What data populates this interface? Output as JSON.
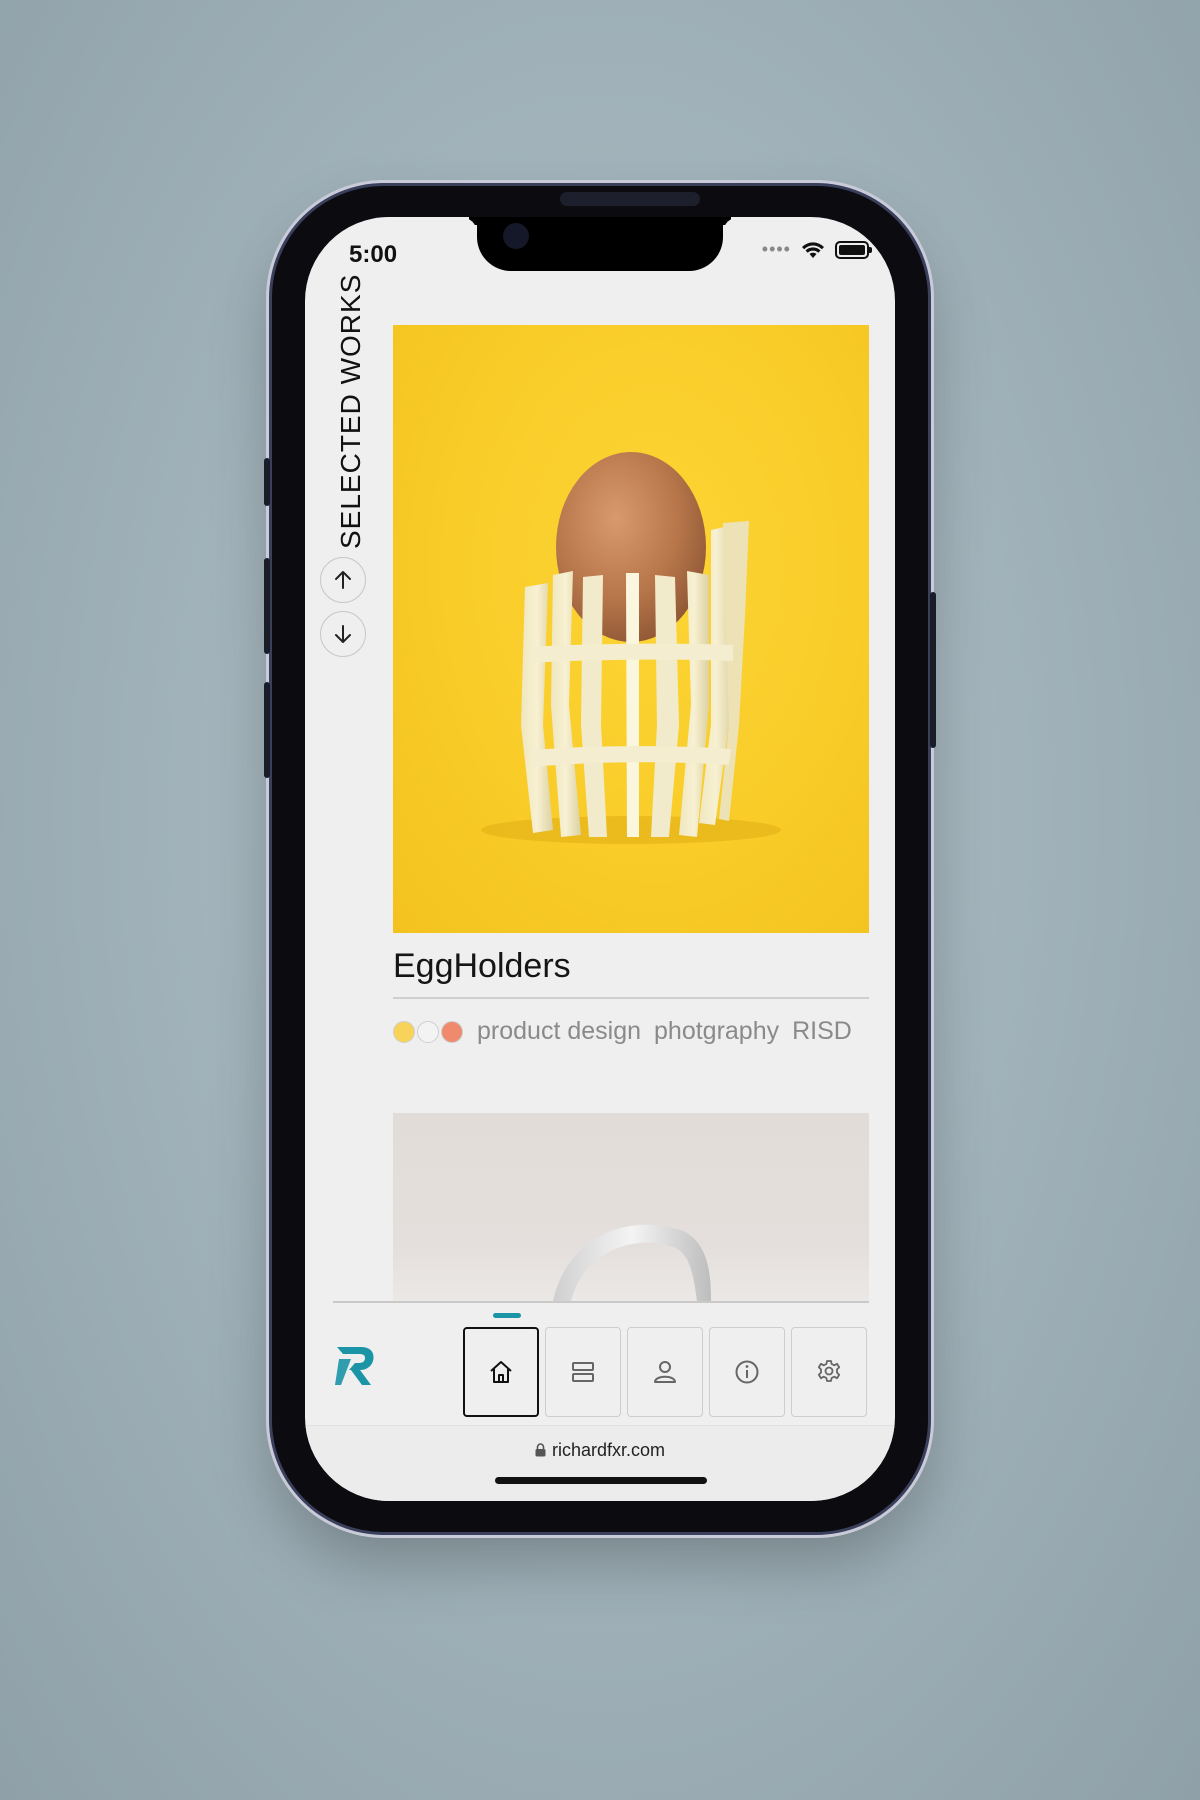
{
  "status_bar": {
    "time": "5:00",
    "signal_icon": "cellular-dots-icon",
    "wifi_icon": "wifi-icon",
    "battery_icon": "battery-icon"
  },
  "sidebar": {
    "section_title": "SELECTED WORKS",
    "up_icon": "arrow-up-icon",
    "down_icon": "arrow-down-icon"
  },
  "project": {
    "title": "EggHolders",
    "swatches": [
      "#f7d35a",
      "#f3f3f3",
      "#f08a6c"
    ],
    "tags": [
      "product design",
      "photgraphy",
      "RISD"
    ]
  },
  "bottom_nav": {
    "items": [
      {
        "icon": "home-icon",
        "active": true
      },
      {
        "icon": "list-icon",
        "active": false
      },
      {
        "icon": "user-icon",
        "active": false
      },
      {
        "icon": "info-icon",
        "active": false
      },
      {
        "icon": "gear-icon",
        "active": false
      }
    ],
    "accent": "#1b94a6"
  },
  "browser": {
    "url": "richardfxr.com"
  }
}
